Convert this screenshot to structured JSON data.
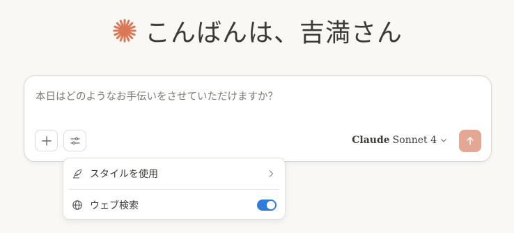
{
  "greeting": {
    "text": "こんばんは、吉満さん",
    "accent_color": "#d97757",
    "icon": "claude-spark-icon"
  },
  "composer": {
    "placeholder": "本日はどのようなお手伝いをさせていただけますか？",
    "add_icon": "plus-icon",
    "tools_icon": "sliders-icon",
    "model": {
      "brand": "Claude",
      "version": "Sonnet 4"
    },
    "send_icon": "arrow-up-icon",
    "send_color": "#e3a794"
  },
  "menu": {
    "items": [
      {
        "label": "スタイルを使用",
        "icon": "feather-icon",
        "trailing": "chevron-right-icon"
      },
      {
        "label": "ウェブ検索",
        "icon": "globe-icon",
        "toggle_on": true,
        "toggle_color": "#2f7bd8"
      }
    ]
  }
}
